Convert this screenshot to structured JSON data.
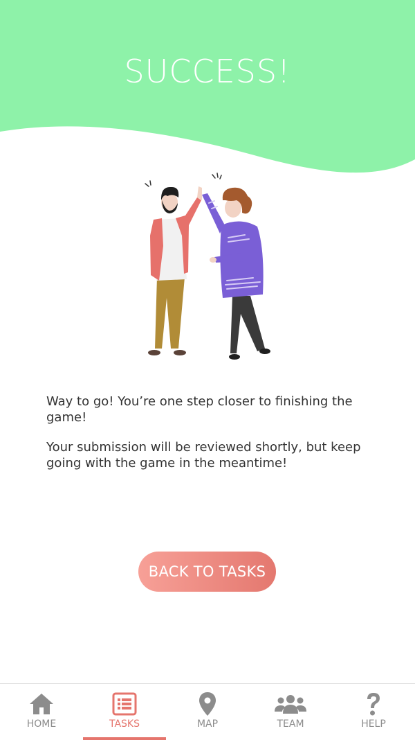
{
  "header": {
    "title": "SUCCESS!",
    "color": "#8ef2a9"
  },
  "message": {
    "line1": "Way to go! You’re one step closer to finishing the game!",
    "line2": "Your submission will be reviewed shortly, but keep going with the game in the meantime!"
  },
  "cta": {
    "label": "BACK TO TASKS"
  },
  "tabbar": {
    "active_color": "#e5756d",
    "inactive_color": "#8c8c8c",
    "tabs": [
      {
        "label": "HOME",
        "icon": "home-icon"
      },
      {
        "label": "TASKS",
        "icon": "tasks-list-icon",
        "active": true
      },
      {
        "label": "MAP",
        "icon": "map-pin-icon"
      },
      {
        "label": "TEAM",
        "icon": "team-icon"
      },
      {
        "label": "HELP",
        "icon": "help-icon"
      }
    ]
  }
}
